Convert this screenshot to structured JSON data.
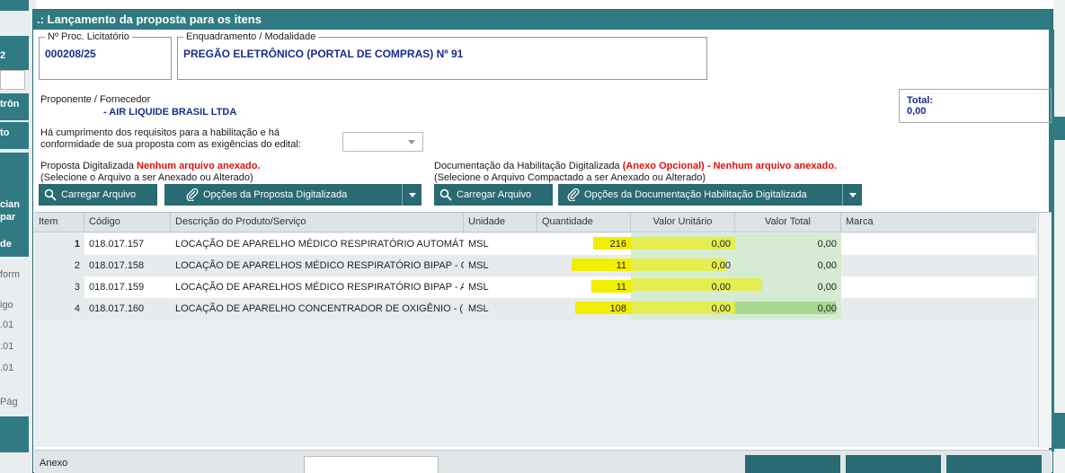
{
  "background": {
    "left_labels": [
      "2",
      "trôn",
      "to",
      "cian",
      "par",
      "de",
      "form",
      "igo",
      ".01",
      ".01",
      ".01",
      "Pág"
    ]
  },
  "dialog": {
    "title": ".: Lançamento da proposta para os itens",
    "proc": {
      "legend": "Nº Proc. Licitatório",
      "value": "000208/25"
    },
    "modalidade": {
      "legend": "Enquadramento / Modalidade",
      "value": "PREGÃO ELETRÔNICO (PORTAL DE COMPRAS) Nº 91"
    },
    "proponente": {
      "label": "Proponente / Fornecedor",
      "value": "-  AIR LIQUIDE BRASIL LTDA"
    },
    "total": {
      "label": "Total:",
      "value": "0,00"
    },
    "requisitos": {
      "line1": "Há cumprimento dos requisitos para a habilitação e há",
      "line2": "conformidade de sua proposta com as exigências do edital:",
      "selected": ""
    },
    "proposta": {
      "label": "Proposta Digitalizada",
      "status": "Nenhum arquivo anexado.",
      "hint": "(Selecione o Arquivo a ser Anexado ou Alterado)",
      "btn_load": "Carregar Arquivo",
      "btn_options": "Opções da Proposta Digitalizada"
    },
    "documentacao": {
      "label": "Documentação da Habilitação Digitalizada",
      "status": "(Anexo Opcional) - Nenhum arquivo anexado.",
      "hint": "(Selecione o Arquivo Compactado a ser Anexado ou Alterado)",
      "btn_load": "Carregar Arquivo",
      "btn_options": "Opções da Documentação Habilitação Digitalizada"
    },
    "grid": {
      "columns": [
        "Item",
        "Código",
        "Descrição do Produto/Serviço",
        "Unidade",
        "Quantidade",
        "Valor Unitário",
        "Valor Total",
        "Marca"
      ],
      "rows": [
        {
          "item": "1",
          "codigo": "018.017.157",
          "descricao": "LOCAÇÃO DE APARELHO MÉDICO RESPIRATÓRIO AUTOMÁT",
          "unidade": "MSL",
          "quantidade": "216",
          "unitario": "0,00",
          "total": "0,00",
          "marca": ""
        },
        {
          "item": "2",
          "codigo": "018.017.158",
          "descricao": "LOCAÇÃO DE APARELHOS MÉDICO RESPIRATÓRIO BIPAP - C",
          "unidade": "MSL",
          "quantidade": "11",
          "unitario": "0,00",
          "total": "0,00",
          "marca": ""
        },
        {
          "item": "3",
          "codigo": "018.017.159",
          "descricao": "LOCAÇÃO DE APARELHOS MÉDICO RESPIRATÓRIO BIPAP - A",
          "unidade": "MSL",
          "quantidade": "11",
          "unitario": "0,00",
          "total": "0,00",
          "marca": ""
        },
        {
          "item": "4",
          "codigo": "018.017.160",
          "descricao": "LOCAÇÃO DE APARELHO CONCENTRADOR DE OXIGÊNIO - (",
          "unidade": "MSL",
          "quantidade": "108",
          "unitario": "0,00",
          "total": "0,00",
          "marca": ""
        }
      ]
    },
    "bottom": {
      "label": "Anexo"
    }
  },
  "colors": {
    "teal": "#2f7a83",
    "dark_teal": "#2a6a72",
    "brand_blue": "#1a2c8c",
    "warning_red": "#e01010",
    "highlight_yellow": "#f2ee00",
    "highlight_green": "#a8d890"
  }
}
